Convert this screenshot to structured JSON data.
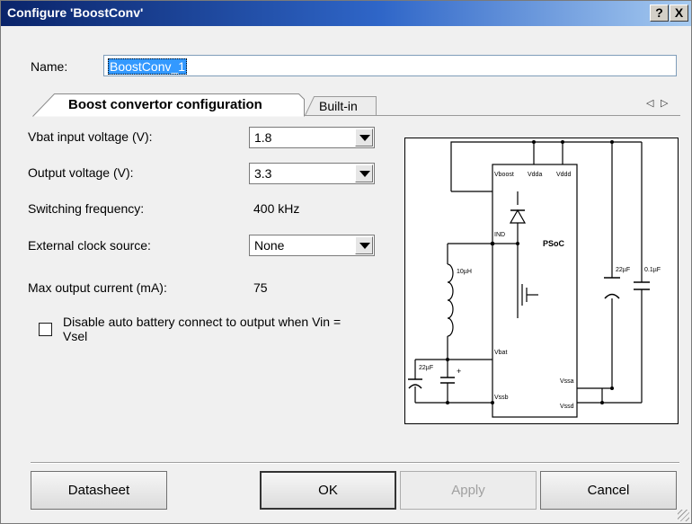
{
  "window": {
    "title": "Configure 'BoostConv'",
    "help_label": "?",
    "close_label": "X"
  },
  "name": {
    "label": "Name:",
    "value": "BoostConv_1"
  },
  "tabs": {
    "items": [
      {
        "label": "Boost convertor configuration"
      },
      {
        "label": "Built-in"
      }
    ],
    "prev_glyph": "◁",
    "next_glyph": "▷"
  },
  "config": {
    "vbat": {
      "label": "Vbat input voltage (V):",
      "value": "1.8"
    },
    "vout": {
      "label": "Output voltage (V):",
      "value": "3.3"
    },
    "freq": {
      "label": "Switching frequency:",
      "value": "400 kHz"
    },
    "clock": {
      "label": "External clock source:",
      "value": "None"
    },
    "max_current": {
      "label": "Max output current (mA):",
      "value": "75"
    },
    "disable_auto": {
      "label": "Disable auto battery connect to output when Vin = Vsel",
      "checked": false
    }
  },
  "schematic": {
    "pins": {
      "vboost": "Vboost",
      "vdda": "Vdda",
      "vddd": "Vddd",
      "ind": "IND",
      "vbat": "Vbat",
      "vssb": "Vssb",
      "vssa": "Vssa",
      "vssd": "Vssd"
    },
    "chip": "PSoC",
    "parts": {
      "inductor": "10µH",
      "cap_in": "22µF",
      "cap_out1": "22µF",
      "cap_out2": "0.1µF",
      "plus": "+"
    }
  },
  "buttons": {
    "datasheet": "Datasheet",
    "ok": "OK",
    "apply": "Apply",
    "cancel": "Cancel"
  }
}
